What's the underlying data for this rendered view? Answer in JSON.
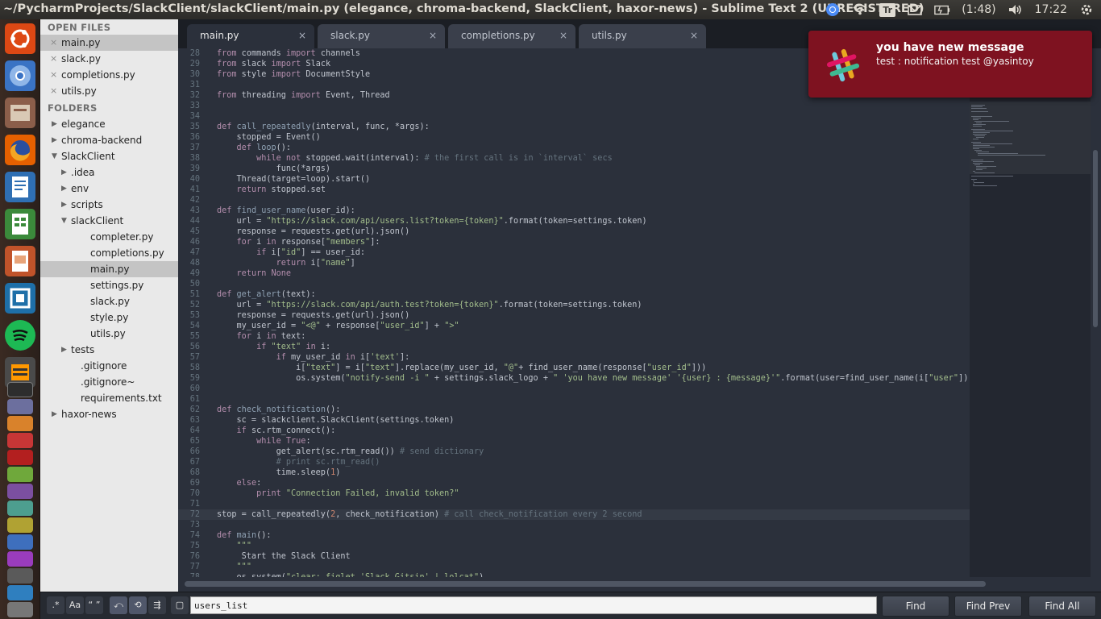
{
  "window_title": "~/PycharmProjects/SlackClient/slackClient/main.py (elegance, chroma-backend, SlackClient, haxor-news) - Sublime Text 2 (UNREGISTERED)",
  "tray": {
    "battery": "(1:48)",
    "clock": "17:22",
    "input_indicator": "Tr"
  },
  "sidebar": {
    "open_files_header": "OPEN FILES",
    "open_files": [
      "main.py",
      "slack.py",
      "completions.py",
      "utils.py"
    ],
    "folders_header": "FOLDERS",
    "tree": [
      {
        "label": "elegance",
        "depth": 0,
        "kind": "folder",
        "open": false
      },
      {
        "label": "chroma-backend",
        "depth": 0,
        "kind": "folder",
        "open": false
      },
      {
        "label": "SlackClient",
        "depth": 0,
        "kind": "folder",
        "open": true
      },
      {
        "label": ".idea",
        "depth": 1,
        "kind": "folder",
        "open": false
      },
      {
        "label": "env",
        "depth": 1,
        "kind": "folder",
        "open": false
      },
      {
        "label": "scripts",
        "depth": 1,
        "kind": "folder",
        "open": false
      },
      {
        "label": "slackClient",
        "depth": 1,
        "kind": "folder",
        "open": true
      },
      {
        "label": "completer.py",
        "depth": 2,
        "kind": "file"
      },
      {
        "label": "completions.py",
        "depth": 2,
        "kind": "file"
      },
      {
        "label": "main.py",
        "depth": 2,
        "kind": "file",
        "selected": true
      },
      {
        "label": "settings.py",
        "depth": 2,
        "kind": "file"
      },
      {
        "label": "slack.py",
        "depth": 2,
        "kind": "file"
      },
      {
        "label": "style.py",
        "depth": 2,
        "kind": "file"
      },
      {
        "label": "utils.py",
        "depth": 2,
        "kind": "file"
      },
      {
        "label": "tests",
        "depth": 1,
        "kind": "folder",
        "open": false
      },
      {
        "label": ".gitignore",
        "depth": 1,
        "kind": "file"
      },
      {
        "label": ".gitignore~",
        "depth": 1,
        "kind": "file"
      },
      {
        "label": "requirements.txt",
        "depth": 1,
        "kind": "file"
      },
      {
        "label": "haxor-news",
        "depth": 0,
        "kind": "folder",
        "open": false
      }
    ]
  },
  "tabs": [
    {
      "label": "main.py",
      "active": true
    },
    {
      "label": "slack.py",
      "active": false
    },
    {
      "label": "completions.py",
      "active": false
    },
    {
      "label": "utils.py",
      "active": false
    }
  ],
  "tab_close_glyph": "×",
  "editor": {
    "current_line": 72,
    "lines": [
      {
        "n": "28",
        "t": "from commands import channels"
      },
      {
        "n": "29",
        "t": "from slack import Slack"
      },
      {
        "n": "30",
        "t": "from style import DocumentStyle"
      },
      {
        "n": "31",
        "t": ""
      },
      {
        "n": "32",
        "t": "from threading import Event, Thread"
      },
      {
        "n": "33",
        "t": ""
      },
      {
        "n": "34",
        "t": ""
      },
      {
        "n": "35",
        "t": "def call_repeatedly(interval, func, *args):"
      },
      {
        "n": "36",
        "t": "    stopped = Event()"
      },
      {
        "n": "37",
        "t": "    def loop():"
      },
      {
        "n": "38",
        "t": "        while not stopped.wait(interval): # the first call is in `interval` secs"
      },
      {
        "n": "39",
        "t": "            func(*args)"
      },
      {
        "n": "40",
        "t": "    Thread(target=loop).start()"
      },
      {
        "n": "41",
        "t": "    return stopped.set"
      },
      {
        "n": "42",
        "t": ""
      },
      {
        "n": "43",
        "t": "def find_user_name(user_id):"
      },
      {
        "n": "44",
        "t": "    url = \"https://slack.com/api/users.list?token={token}\".format(token=settings.token)"
      },
      {
        "n": "45",
        "t": "    response = requests.get(url).json()"
      },
      {
        "n": "46",
        "t": "    for i in response[\"members\"]:"
      },
      {
        "n": "47",
        "t": "        if i[\"id\"] == user_id:"
      },
      {
        "n": "48",
        "t": "            return i[\"name\"]"
      },
      {
        "n": "49",
        "t": "    return None"
      },
      {
        "n": "50",
        "t": ""
      },
      {
        "n": "51",
        "t": "def get_alert(text):"
      },
      {
        "n": "52",
        "t": "    url = \"https://slack.com/api/auth.test?token={token}\".format(token=settings.token)"
      },
      {
        "n": "53",
        "t": "    response = requests.get(url).json()"
      },
      {
        "n": "54",
        "t": "    my_user_id = \"<@\" + response[\"user_id\"] + \">\""
      },
      {
        "n": "55",
        "t": "    for i in text:"
      },
      {
        "n": "56",
        "t": "        if \"text\" in i:"
      },
      {
        "n": "57",
        "t": "            if my_user_id in i['text']:"
      },
      {
        "n": "58",
        "t": "                i[\"text\"] = i[\"text\"].replace(my_user_id, \"@\"+ find_user_name(response[\"user_id\"]))"
      },
      {
        "n": "59",
        "t": "                os.system(\"notify-send -i \" + settings.slack_logo + \" 'you have new message' '{user} : {message}'\".format(user=find_user_name(i[\"user\"]), me"
      },
      {
        "n": "60",
        "t": ""
      },
      {
        "n": "61",
        "t": ""
      },
      {
        "n": "62",
        "t": "def check_notification():"
      },
      {
        "n": "63",
        "t": "    sc = slackclient.SlackClient(settings.token)"
      },
      {
        "n": "64",
        "t": "    if sc.rtm_connect():"
      },
      {
        "n": "65",
        "t": "        while True:"
      },
      {
        "n": "66",
        "t": "            get_alert(sc.rtm_read()) # send dictionary"
      },
      {
        "n": "67",
        "t": "            # print sc.rtm_read()"
      },
      {
        "n": "68",
        "t": "            time.sleep(1)"
      },
      {
        "n": "69",
        "t": "    else:"
      },
      {
        "n": "70",
        "t": "        print \"Connection Failed, invalid token?\""
      },
      {
        "n": "71",
        "t": ""
      },
      {
        "n": "72",
        "t": "stop = call_repeatedly(2, check_notification) # call check_notification every 2 second"
      },
      {
        "n": "73",
        "t": ""
      },
      {
        "n": "74",
        "t": "def main():"
      },
      {
        "n": "75",
        "t": "    \"\"\""
      },
      {
        "n": "76",
        "t": "     Start the Slack Client"
      },
      {
        "n": "77",
        "t": "    \"\"\""
      },
      {
        "n": "78",
        "t": "    os.system(\"clear; figlet 'Slack Gitsin' | lolcat\")"
      }
    ]
  },
  "find_panel": {
    "query": "users_list",
    "options": [
      {
        "name": "regex-toggle",
        "glyph": ".*",
        "on": false
      },
      {
        "name": "case-toggle",
        "glyph": "Aa",
        "on": false
      },
      {
        "name": "whole-word-toggle",
        "glyph": "“ ”",
        "on": false
      },
      {
        "name": "reverse-toggle",
        "glyph": "⤺",
        "on": true
      },
      {
        "name": "wrap-toggle",
        "glyph": "⟲",
        "on": true
      },
      {
        "name": "in-selection-toggle",
        "glyph": "⇶",
        "on": false
      },
      {
        "name": "highlight-toggle",
        "glyph": "▢",
        "on": false
      }
    ],
    "buttons": {
      "find": "Find",
      "find_prev": "Find Prev",
      "find_all": "Find All"
    }
  },
  "notification": {
    "title": "you have new message",
    "body": "test : notification test @yasintoy",
    "icon": "slack-logo-icon",
    "background": "#7e1220"
  },
  "colors": {
    "editor_bg": "#2b303b",
    "keyword": "#b48ead",
    "string": "#a3be8c",
    "comment": "#65737e",
    "number": "#d08770"
  }
}
